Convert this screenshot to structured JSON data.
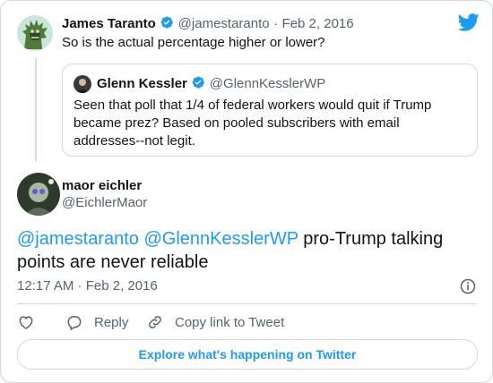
{
  "reply_tweet": {
    "author_name": "James Taranto",
    "author_handle": "@jamestaranto",
    "separator": "·",
    "date": "Feb 2, 2016",
    "text": "So is the actual percentage higher or lower?"
  },
  "quoted_tweet": {
    "author_name": "Glenn Kessler",
    "author_handle": "@GlennKesslerWP",
    "text_line1": "Seen that poll that 1/4 of federal workers would quit if Trump",
    "text_line2": "became prez? Based on pooled subscribers with email",
    "text_line3": "addresses--not legit."
  },
  "main_tweet": {
    "author_name": "maor eichler",
    "author_handle": "@EichlerMaor",
    "mention1": "@jamestaranto",
    "mention2": "@GlennKesslerWP",
    "text_part1": " pro-Trump talking",
    "text_line2": "points are never reliable",
    "timestamp": "12:17 AM · Feb 2, 2016"
  },
  "actions": {
    "reply_label": "Reply",
    "copy_label": "Copy link to Tweet"
  },
  "explore_label": "Explore what's happening on Twitter",
  "icons": {
    "twitter": "twitter-bird-icon",
    "verified": "verified-badge-icon",
    "like": "heart-icon",
    "reply": "speech-bubble-icon",
    "copy": "link-icon",
    "info": "info-icon"
  },
  "colors": {
    "brand_blue": "#1d9bf0",
    "text": "#0f1419",
    "muted": "#536471",
    "border": "#cfd9de"
  }
}
